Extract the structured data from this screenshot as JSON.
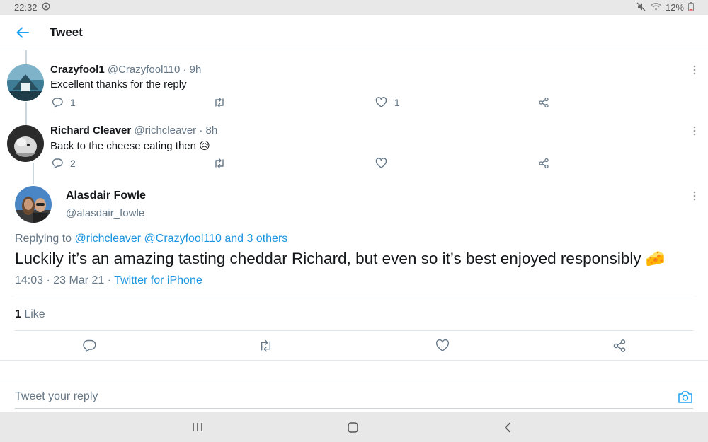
{
  "status_bar": {
    "time": "22:32",
    "battery": "12%",
    "icons": [
      "whatsapp-icon",
      "mute-icon",
      "wifi-icon",
      "battery-icon"
    ]
  },
  "header": {
    "back_icon": "arrow-left-icon",
    "title": "Tweet"
  },
  "replies": [
    {
      "name": "Crazyfool1",
      "meta": "@Crazyfool110 · 9h",
      "text": "Excellent thanks for the reply",
      "reply_count": "1",
      "retweet_count": "",
      "like_count": "1"
    },
    {
      "name": "Richard Cleaver",
      "meta": "@richcleaver · 8h",
      "text": "Back to the cheese eating then 😥",
      "reply_count": "2",
      "retweet_count": "",
      "like_count": ""
    }
  ],
  "main_tweet": {
    "name": "Alasdair Fowle",
    "handle": "@alasdair_fowle",
    "replying_prefix": "Replying to ",
    "replying_links": "@richcleaver @Crazyfool110 and 3 others",
    "text": "Luckily it’s an amazing tasting cheddar Richard, but even so it’s best enjoyed responsibly 🧀",
    "timestamp": "14:03 · 23 Mar 21 · ",
    "source": "Twitter for iPhone",
    "likes_count": "1",
    "likes_label": " Like"
  },
  "compose": {
    "placeholder": "Tweet your reply"
  },
  "colors": {
    "accent": "#1da1f2",
    "link": "#1b95e0",
    "secondary_text": "#657786",
    "primary_text": "#14171a"
  }
}
